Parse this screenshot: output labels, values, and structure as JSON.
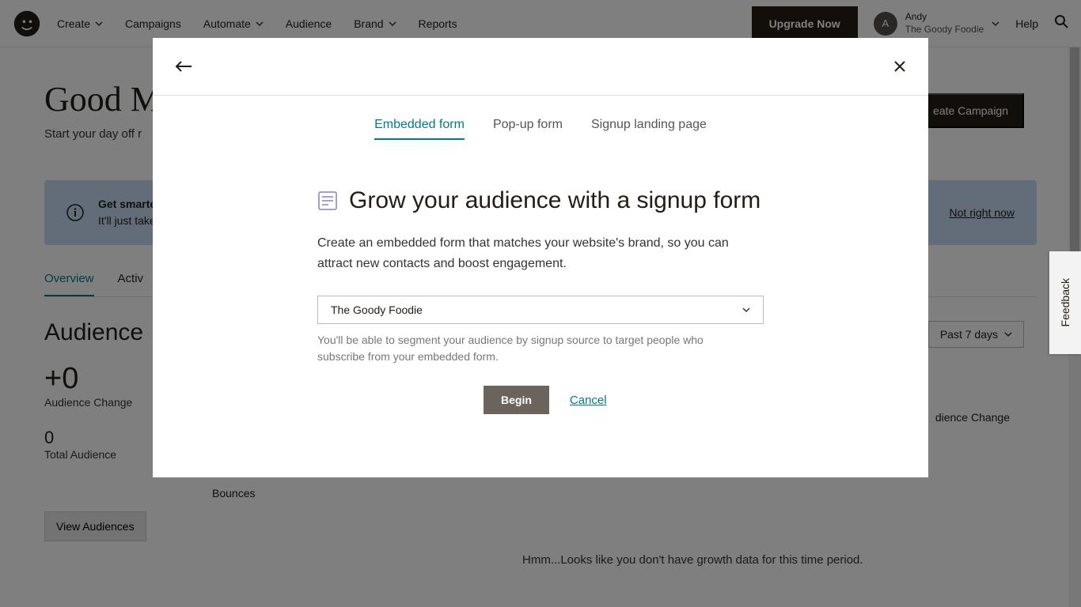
{
  "topbar": {
    "nav": [
      {
        "label": "Create",
        "chev": true
      },
      {
        "label": "Campaigns",
        "chev": false
      },
      {
        "label": "Automate",
        "chev": true
      },
      {
        "label": "Audience",
        "chev": false
      },
      {
        "label": "Brand",
        "chev": true
      },
      {
        "label": "Reports",
        "chev": false
      }
    ],
    "upgrade": "Upgrade Now",
    "user": {
      "initial": "A",
      "name": "Andy",
      "org": "The Goody Foodie"
    },
    "help": "Help"
  },
  "page": {
    "title": "Good M",
    "subtitle": "Start your day off r",
    "banner": {
      "line1": "Get smarter r",
      "line2": "It'll just take a",
      "action": "Not right now"
    },
    "tabs": [
      "Overview",
      "Activ"
    ],
    "audience_heading": "Audience",
    "metrics": {
      "change_val": "+0",
      "change_label": "Audience Change",
      "total_val": "0",
      "total_label": "Total Audience"
    },
    "view_audiences": "View Audiences",
    "create_campaign": "eate Campaign",
    "period": "Past 7 days",
    "aud_change_right": "dience Change",
    "no_growth": "Hmm...Looks like you don't have growth data for this time period.",
    "bounces": "Bounces"
  },
  "modal": {
    "tabs": [
      "Embedded form",
      "Pop-up form",
      "Signup landing page"
    ],
    "heading": "Grow your audience with a signup form",
    "description": "Create an embedded form that matches your website's brand, so you can attract new contacts and boost engagement.",
    "select_value": "The Goody Foodie",
    "helper": "You'll be able to segment your audience by signup source to target people who subscribe from your embedded form.",
    "begin": "Begin",
    "cancel": "Cancel"
  },
  "feedback": "Feedback"
}
